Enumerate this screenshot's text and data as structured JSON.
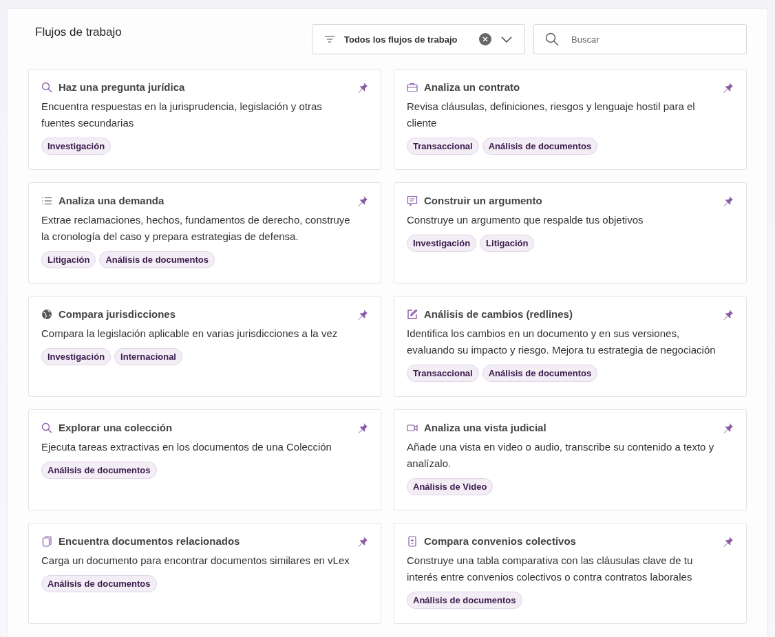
{
  "header": {
    "title": "Flujos de trabajo",
    "filter": {
      "value": "Todos los flujos de trabajo"
    },
    "search": {
      "placeholder": "Buscar"
    }
  },
  "workflows": [
    {
      "kind": "search",
      "title": "Haz una pregunta jurídica",
      "description": "Encuentra respuestas en la jurisprudencia, legislación y otras fuentes secundarias",
      "tags": [
        "Investigación"
      ]
    },
    {
      "kind": "briefcase",
      "title": "Analiza un contrato",
      "description": "Revisa cláusulas, definiciones, riesgos y lenguaje hostil para el cliente",
      "tags": [
        "Transaccional",
        "Análisis de documentos"
      ]
    },
    {
      "kind": "list",
      "title": "Analiza una demanda",
      "description": "Extrae reclamaciones, hechos, fundamentos de derecho, construye la cronología del caso y prepara estrategias de defensa.",
      "tags": [
        "Litigación",
        "Análisis de documentos"
      ]
    },
    {
      "kind": "chat",
      "title": "Construir un argumento",
      "description": "Construye un argumento que respalde tus objetivos",
      "tags": [
        "Investigación",
        "Litigación"
      ]
    },
    {
      "kind": "globe",
      "title": "Compara jurisdicciones",
      "description": "Compara la legislación aplicable en varias jurisdicciones a la vez",
      "tags": [
        "Investigación",
        "Internacional"
      ]
    },
    {
      "kind": "edit",
      "title": "Análisis de cambios (redlines)",
      "description": "Identifica los cambios en un documento y en sus versiones, evaluando su impacto y riesgo. Mejora tu estrategia de negociación",
      "tags": [
        "Transaccional",
        "Análisis de documentos"
      ]
    },
    {
      "kind": "search",
      "title": "Explorar una colección",
      "description": "Ejecuta tareas extractivas en los documentos de una Colección",
      "tags": [
        "Análisis de documentos"
      ]
    },
    {
      "kind": "video",
      "title": "Analiza una vista judicial",
      "description": "Añade una vista en video o audio, transcribe su contenido a texto y analízalo.",
      "tags": [
        "Análisis de Video"
      ]
    },
    {
      "kind": "copy",
      "title": "Encuentra documentos relacionados",
      "description": "Carga un documento para encontrar documentos similares en vLex",
      "tags": [
        "Análisis de documentos"
      ]
    },
    {
      "kind": "diff",
      "title": "Compara convenios colectivos",
      "description": "Construye una tabla comparativa con las cláusulas clave de tu interés entre convenios colectivos o contra contratos laborales",
      "tags": [
        "Análisis de documentos"
      ]
    }
  ]
}
